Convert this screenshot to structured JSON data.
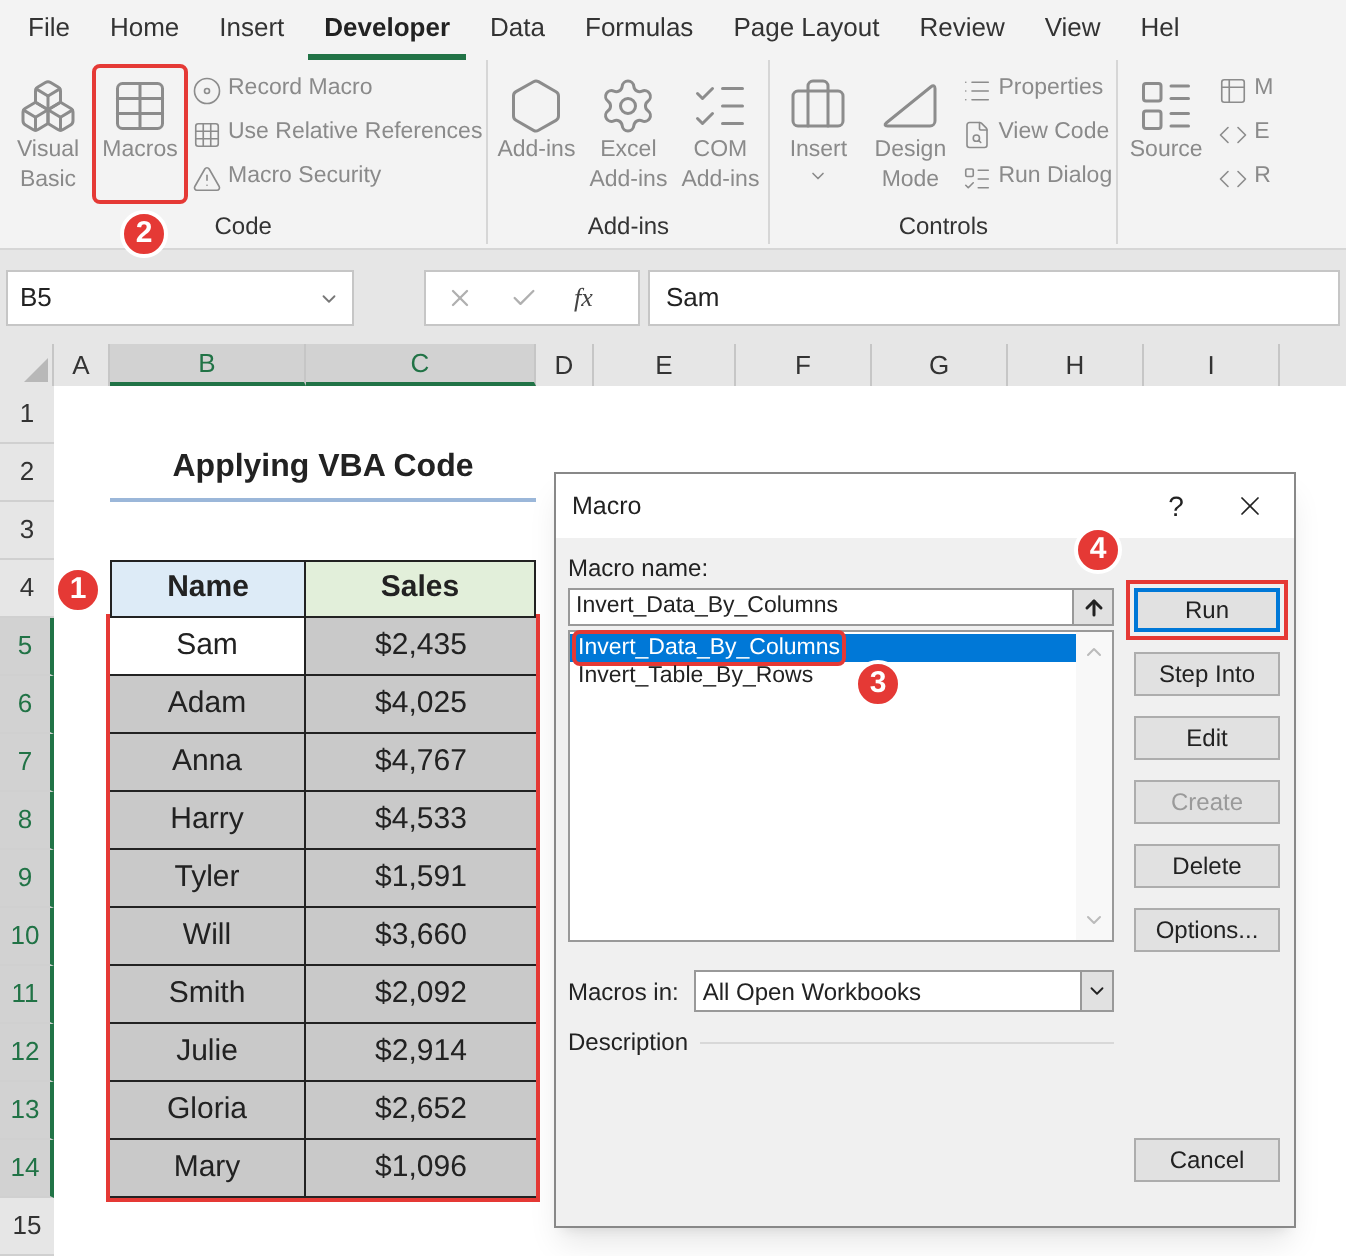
{
  "menu_tabs": [
    {
      "label": "File",
      "selected": false
    },
    {
      "label": "Home",
      "selected": false
    },
    {
      "label": "Insert",
      "selected": false
    },
    {
      "label": "Developer",
      "selected": true
    },
    {
      "label": "Data",
      "selected": false
    },
    {
      "label": "Formulas",
      "selected": false
    },
    {
      "label": "Page Layout",
      "selected": false
    },
    {
      "label": "Review",
      "selected": false
    },
    {
      "label": "View",
      "selected": false
    },
    {
      "label": "Hel",
      "selected": false
    }
  ],
  "ribbon": {
    "groups": [
      {
        "label": "Code",
        "items": [
          {
            "kind": "large",
            "label": "Visual Basic"
          },
          {
            "kind": "large",
            "label": "Macros",
            "callout": "2"
          },
          {
            "kind": "small",
            "label": "Record Macro"
          },
          {
            "kind": "small",
            "label": "Use Relative References"
          },
          {
            "kind": "small",
            "label": "Macro Security"
          }
        ]
      },
      {
        "label": "Add-ins",
        "items": [
          {
            "kind": "large",
            "label": "Add-ins"
          },
          {
            "kind": "large",
            "label": "Excel Add-ins"
          },
          {
            "kind": "large",
            "label": "COM Add-ins"
          }
        ]
      },
      {
        "label": "Controls",
        "items": [
          {
            "kind": "dropdown",
            "label": "Insert"
          },
          {
            "kind": "large",
            "label": "Design Mode"
          },
          {
            "kind": "small",
            "label": "Properties"
          },
          {
            "kind": "small",
            "label": "View Code"
          },
          {
            "kind": "small",
            "label": "Run Dialog"
          }
        ]
      },
      {
        "items": [
          {
            "kind": "large",
            "label": "Source"
          },
          {
            "kind": "small",
            "label": "M"
          },
          {
            "kind": "small",
            "label": "E"
          },
          {
            "kind": "small",
            "label": "R"
          }
        ]
      }
    ]
  },
  "formula_bar": {
    "name_box": "B5",
    "function_label": "fx",
    "value": "Sam"
  },
  "sheet": {
    "columns": [
      {
        "label": "A",
        "selected": false
      },
      {
        "label": "B",
        "selected": true
      },
      {
        "label": "C",
        "selected": true
      },
      {
        "label": "D",
        "selected": false
      },
      {
        "label": "E",
        "selected": false
      },
      {
        "label": "F",
        "selected": false
      },
      {
        "label": "G",
        "selected": false
      },
      {
        "label": "H",
        "selected": false
      },
      {
        "label": "I",
        "selected": false
      }
    ],
    "row_headers": [
      {
        "label": "1",
        "selected": false
      },
      {
        "label": "2",
        "selected": false
      },
      {
        "label": "3",
        "selected": false
      },
      {
        "label": "4",
        "selected": false
      },
      {
        "label": "5",
        "selected": true
      },
      {
        "label": "6",
        "selected": true
      },
      {
        "label": "7",
        "selected": true
      },
      {
        "label": "8",
        "selected": true
      },
      {
        "label": "9",
        "selected": true
      },
      {
        "label": "10",
        "selected": true
      },
      {
        "label": "11",
        "selected": true
      },
      {
        "label": "12",
        "selected": true
      },
      {
        "label": "13",
        "selected": true
      },
      {
        "label": "14",
        "selected": true
      },
      {
        "label": "15",
        "selected": false
      }
    ],
    "title": "Applying VBA Code",
    "table": {
      "callout": "1",
      "headers": [
        "Name",
        "Sales"
      ],
      "rows": [
        {
          "name": "Sam",
          "sales": "$2,435",
          "active": true
        },
        {
          "name": "Adam",
          "sales": "$4,025",
          "active": false
        },
        {
          "name": "Anna",
          "sales": "$4,767",
          "active": false
        },
        {
          "name": "Harry",
          "sales": "$4,533",
          "active": false
        },
        {
          "name": "Tyler",
          "sales": "$1,591",
          "active": false
        },
        {
          "name": "Will",
          "sales": "$3,660",
          "active": false
        },
        {
          "name": "Smith",
          "sales": "$2,092",
          "active": false
        },
        {
          "name": "Julie",
          "sales": "$2,914",
          "active": false
        },
        {
          "name": "Gloria",
          "sales": "$2,652",
          "active": false
        },
        {
          "name": "Mary",
          "sales": "$1,096",
          "active": false
        }
      ]
    }
  },
  "dialog": {
    "title": "Macro",
    "help": "?",
    "name_label": "Macro name:",
    "name_value": "Invert_Data_By_Columns",
    "macros": [
      {
        "label": "Invert_Data_By_Columns",
        "selected": true,
        "callout": "3"
      },
      {
        "label": "Invert_Table_By_Rows",
        "selected": false
      }
    ],
    "buttons": [
      {
        "label": "Run",
        "default": true,
        "disabled": false,
        "callout": "4"
      },
      {
        "label": "Step Into",
        "default": false,
        "disabled": false
      },
      {
        "label": "Edit",
        "default": false,
        "disabled": false
      },
      {
        "label": "Create",
        "default": false,
        "disabled": true
      },
      {
        "label": "Delete",
        "default": false,
        "disabled": false
      },
      {
        "label": "Options...",
        "default": false,
        "disabled": false
      }
    ],
    "macros_in_label": "Macros in:",
    "macros_in_value": "All Open Workbooks",
    "description_label": "Description",
    "cancel": "Cancel"
  }
}
